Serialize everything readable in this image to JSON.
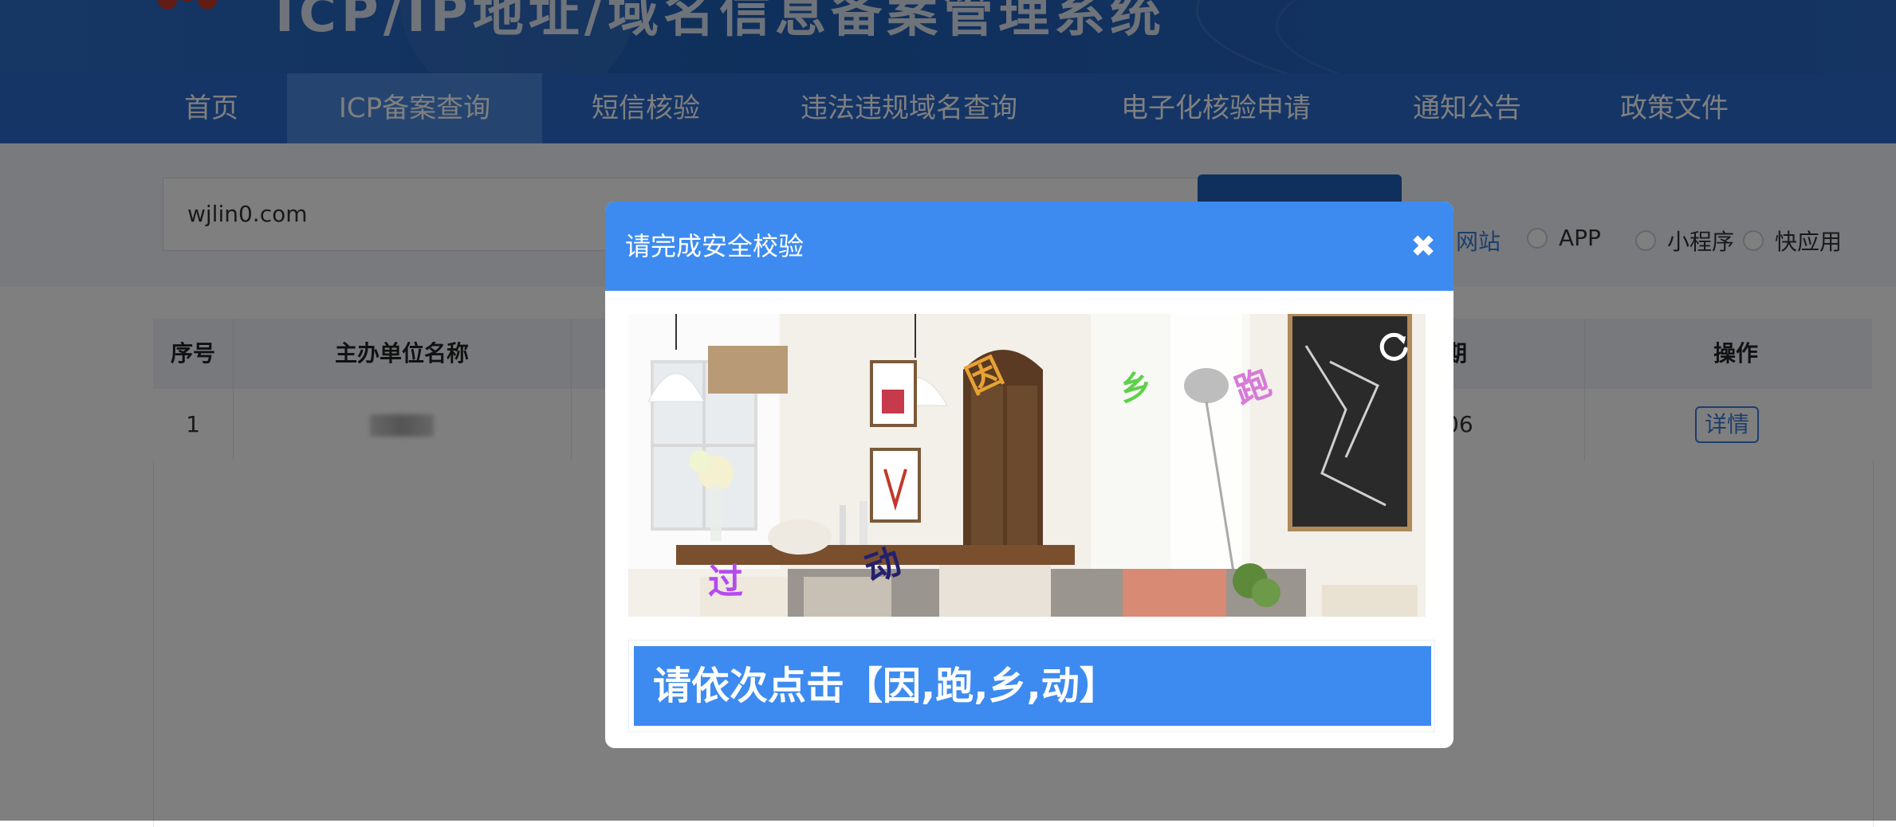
{
  "header": {
    "title": "ICP/IP地址/域名信息备案管理系统"
  },
  "nav": {
    "items": [
      {
        "label": "首页",
        "active": false
      },
      {
        "label": "ICP备案查询",
        "active": true
      },
      {
        "label": "短信核验",
        "active": false
      },
      {
        "label": "违法违规域名查询",
        "active": false
      },
      {
        "label": "电子化核验申请",
        "active": false
      },
      {
        "label": "通知公告",
        "active": false
      },
      {
        "label": "政策文件",
        "active": false
      }
    ]
  },
  "search": {
    "value": "wjlin0.com",
    "types": [
      "网站",
      "APP",
      "小程序",
      "快应用"
    ]
  },
  "table": {
    "headers": {
      "index": "序号",
      "org_name": "主办单位名称",
      "date_fragment": "期",
      "action": "操作"
    },
    "rows": [
      {
        "index": "1",
        "date_fragment": "06",
        "action": "详情"
      }
    ]
  },
  "modal": {
    "title": "请完成安全校验",
    "close_icon": "close-icon",
    "refresh_icon": "refresh-icon",
    "captcha_glyphs": [
      {
        "char": "因",
        "color": "#e8a234"
      },
      {
        "char": "乡",
        "color": "#5ed04b"
      },
      {
        "char": "跑",
        "color": "#d77ad8"
      },
      {
        "char": "过",
        "color": "#b44af0"
      },
      {
        "char": "动",
        "color": "#23206e"
      }
    ],
    "instruction": "请依次点击【因,跑,乡,动】"
  },
  "colors": {
    "header_blue": "#1f5fb8",
    "nav_blue": "#2b6bcc",
    "modal_blue": "#3d8bf0"
  }
}
